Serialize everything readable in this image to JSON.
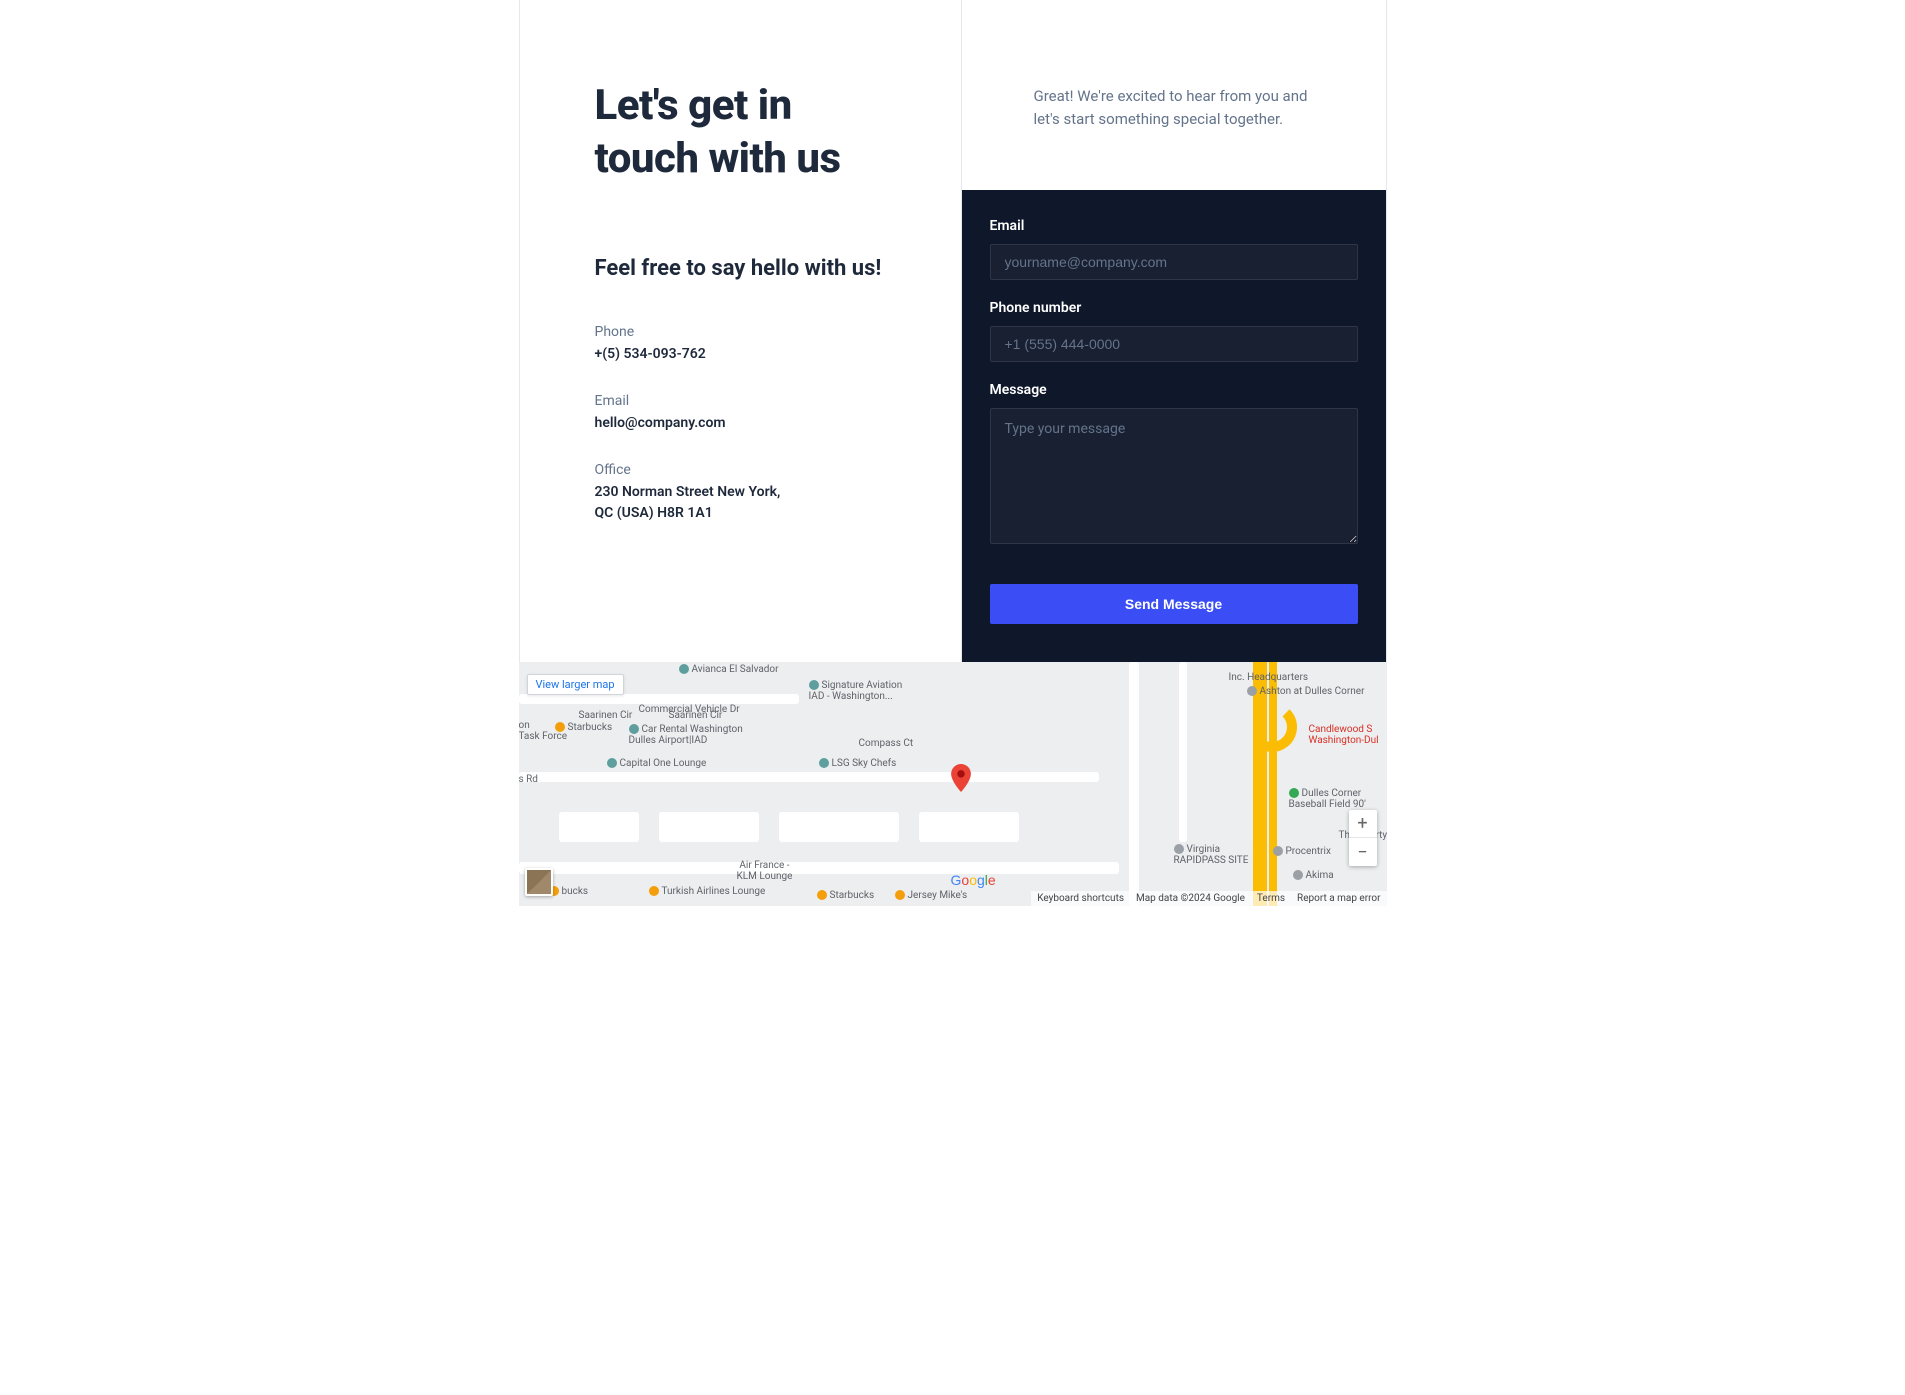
{
  "heading": {
    "main": "Let's get in touch with us",
    "secondary": "Feel free to say hello with us!"
  },
  "contact": {
    "phone_label": "Phone",
    "phone_value": "+(5) 534-093-762",
    "email_label": "Email",
    "email_value": "hello@company.com",
    "office_label": "Office",
    "office_value": "230 Norman Street New York,\nQC (USA) H8R 1A1"
  },
  "intro": "Great! We're excited to hear from you and let's start something special together.",
  "form": {
    "email_label": "Email",
    "email_placeholder": "yourname@company.com",
    "phone_label": "Phone number",
    "phone_placeholder": "+1 (555) 444-0000",
    "message_label": "Message",
    "message_placeholder": "Type your message",
    "submit_label": "Send Message"
  },
  "map": {
    "larger_link": "View larger map",
    "zoom_in": "+",
    "zoom_out": "−",
    "footer": {
      "shortcuts": "Keyboard shortcuts",
      "mapdata": "Map data ©2024 Google",
      "terms": "Terms",
      "report": "Report a map error"
    },
    "pois": {
      "signature": "Signature Aviation\nIAD - Washington...",
      "commercial": "Commercial Vehicle Dr",
      "saarinen1": "Saarinen Cir",
      "saarinen2": "Saarinen Cir",
      "starbucks1": "Starbucks",
      "carrental": "Car Rental Washington\nDulles Airport|IAD",
      "compass": "Compass Ct",
      "taskforce": "on\nTask Force",
      "capitalone": "Capital One Lounge",
      "lsg": "LSG Sky Chefs",
      "rd": "s Rd",
      "airfrance": "Air France -\nKLM Lounge",
      "turkish": "Turkish Airlines Lounge",
      "starbucks2": "Starbucks",
      "jersey": "Jersey Mike's",
      "bucks": "bucks",
      "salvador": "Avianca El Salvador",
      "hq": "Inc. Headquarters",
      "ashton": "Ashton at Dulles Corner",
      "candlewood": "Candlewood S\nWashington-Dul",
      "dullescorner": "Dulles Corner\nBaseball Field 90'",
      "virginia": "Virginia\nRAPIDPASS SITE",
      "procentrix": "Procentrix",
      "akima": "Akima",
      "courty": "The Courty"
    }
  }
}
